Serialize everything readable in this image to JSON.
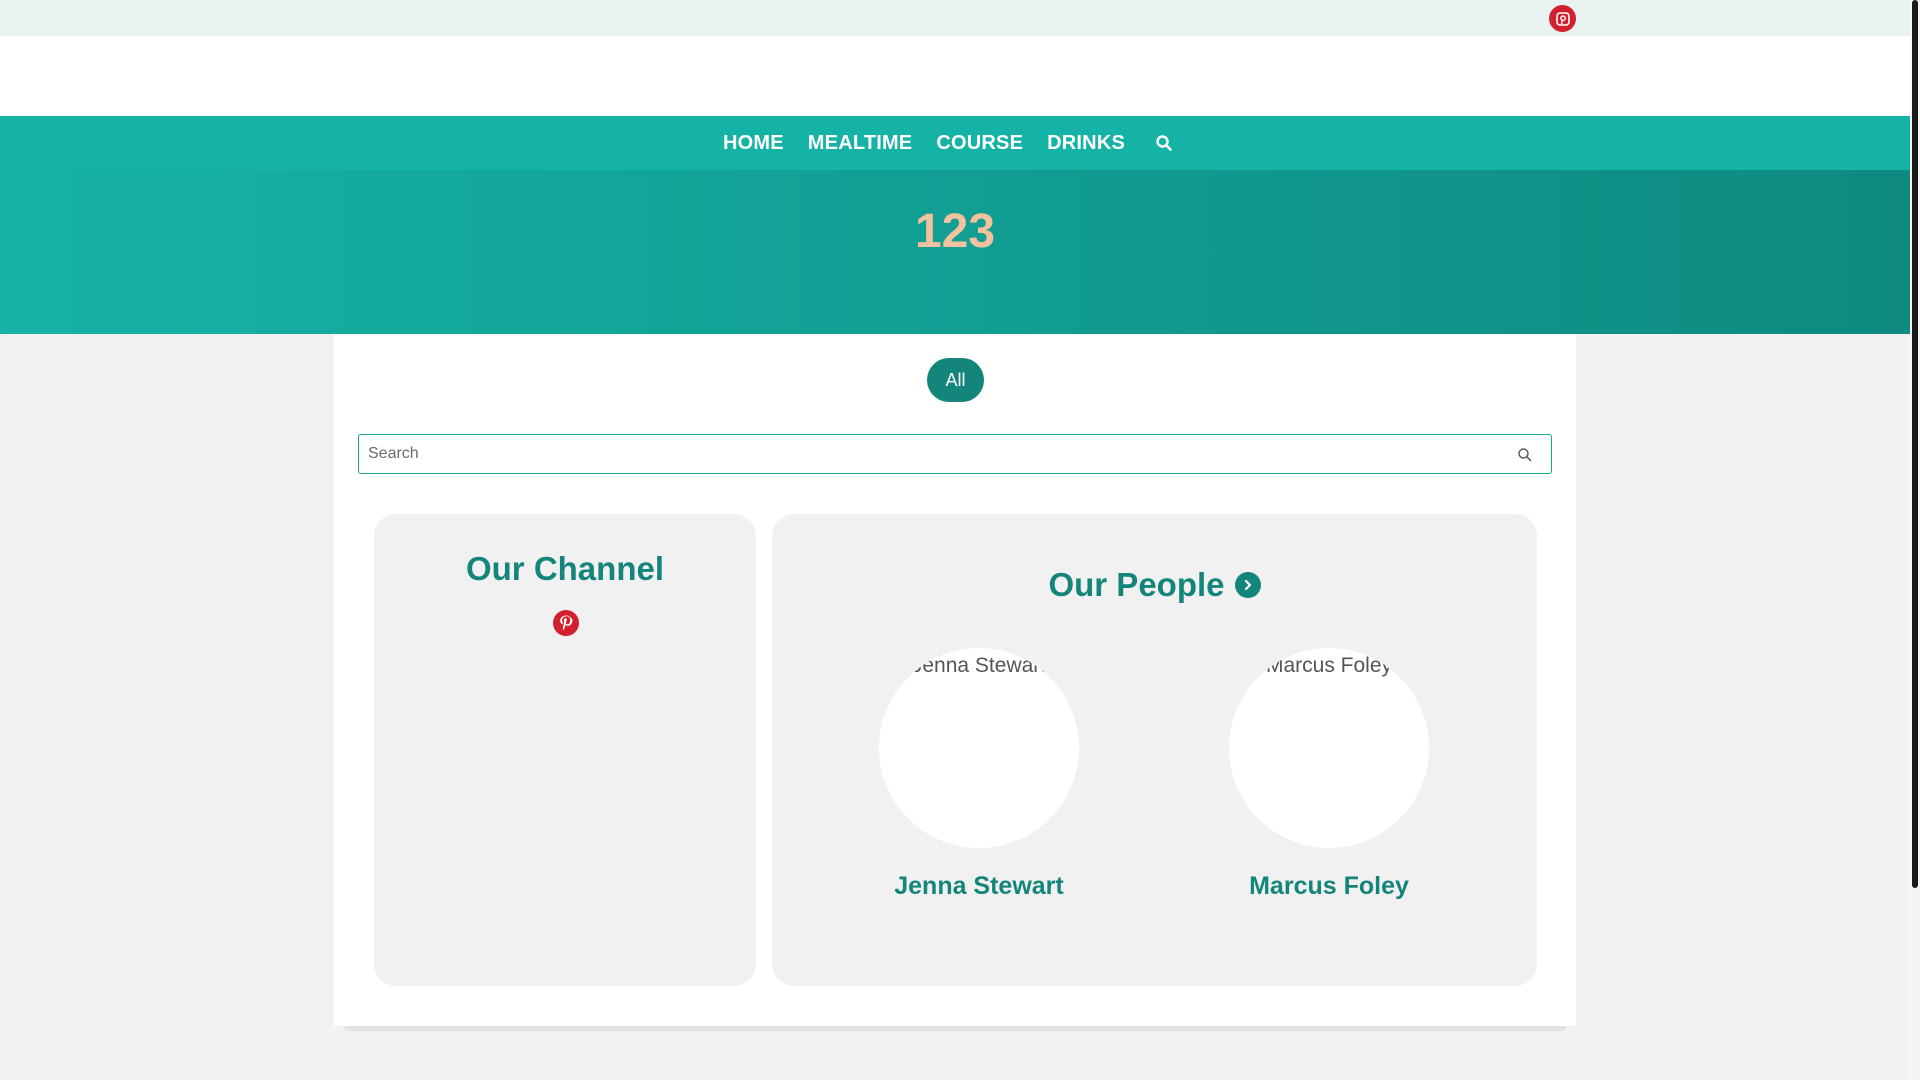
{
  "topbar": {
    "social_icon": "pinterest-icon"
  },
  "nav": {
    "items": [
      "HOME",
      "MEALTIME",
      "COURSE",
      "DRINKS"
    ],
    "search_icon": "search-icon"
  },
  "hero": {
    "title": "123"
  },
  "filter": {
    "all_label": "All"
  },
  "search": {
    "placeholder": "Search",
    "value": ""
  },
  "channel": {
    "title": "Our Channel",
    "icon": "pinterest-icon"
  },
  "people": {
    "title": "Our People",
    "list": [
      {
        "name": "Jenna Stewart",
        "image_alt": "Jenna Stewart"
      },
      {
        "name": "Marcus Foley",
        "image_alt": "Marcus Foley"
      }
    ]
  },
  "colors": {
    "teal": "#15b3a6",
    "dark_teal": "#14857b",
    "hero_title": "#f3c29f",
    "pinterest": "#d3202f"
  }
}
